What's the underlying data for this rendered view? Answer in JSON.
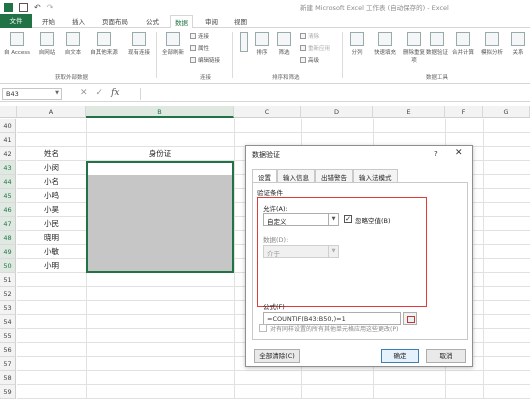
{
  "window": {
    "title": "新建 Microsoft Excel 工作表 (自动保存的) - Excel"
  },
  "tabs": [
    {
      "label": "文件"
    },
    {
      "label": "开始"
    },
    {
      "label": "插入"
    },
    {
      "label": "页面布局"
    },
    {
      "label": "公式"
    },
    {
      "label": "数据"
    },
    {
      "label": "审阅"
    },
    {
      "label": "视图"
    }
  ],
  "ribbon": {
    "get_external": {
      "label": "获取外部数据",
      "items": [
        "自 Access",
        "自网站",
        "自文本",
        "自其他来源",
        "现有连接"
      ]
    },
    "connections": {
      "label": "连接",
      "refresh_all": "全部刷新",
      "items": [
        "连接",
        "属性",
        "编辑链接"
      ]
    },
    "sort_filter": {
      "label": "排序和筛选",
      "sort": "排序",
      "filter": "筛选",
      "items": [
        "清除",
        "重新应用",
        "高级"
      ]
    },
    "data_tools": {
      "label": "数据工具",
      "items": [
        "分列",
        "快速填充",
        "删除重复项",
        "数据验证",
        "合并计算",
        "模拟分析",
        "关系"
      ]
    }
  },
  "formula_bar": {
    "name_box": "B43",
    "formula": ""
  },
  "columns": [
    "A",
    "B",
    "C",
    "D",
    "E",
    "F",
    "G"
  ],
  "rows": [
    {
      "num": "40",
      "a": "",
      "b": ""
    },
    {
      "num": "41",
      "a": "",
      "b": ""
    },
    {
      "num": "42",
      "a": "姓名",
      "b": "身份证"
    },
    {
      "num": "43",
      "a": "小闵",
      "b": ""
    },
    {
      "num": "44",
      "a": "小名",
      "b": ""
    },
    {
      "num": "45",
      "a": "小鸣",
      "b": ""
    },
    {
      "num": "46",
      "a": "小昊",
      "b": ""
    },
    {
      "num": "47",
      "a": "小民",
      "b": ""
    },
    {
      "num": "48",
      "a": "晓明",
      "b": ""
    },
    {
      "num": "49",
      "a": "小敏",
      "b": ""
    },
    {
      "num": "50",
      "a": "小明",
      "b": ""
    },
    {
      "num": "51",
      "a": "",
      "b": ""
    },
    {
      "num": "52",
      "a": "",
      "b": ""
    },
    {
      "num": "53",
      "a": "",
      "b": ""
    },
    {
      "num": "54",
      "a": "",
      "b": ""
    },
    {
      "num": "55",
      "a": "",
      "b": ""
    },
    {
      "num": "56",
      "a": "",
      "b": ""
    },
    {
      "num": "57",
      "a": "",
      "b": ""
    },
    {
      "num": "58",
      "a": "",
      "b": ""
    },
    {
      "num": "59",
      "a": "",
      "b": ""
    }
  ],
  "dialog": {
    "title": "数据验证",
    "help": "?",
    "close": "✕",
    "tabs": [
      "设置",
      "输入信息",
      "出错警告",
      "输入法模式"
    ],
    "section": "验证条件",
    "allow_label": "允许(A):",
    "allow_value": "自定义",
    "ignore_blank": "忽略空值(B)",
    "data_label": "数据(D):",
    "data_value": "介于",
    "formula_label": "公式(F)",
    "formula_value": "=COUNTIF(B43:B50,)=1",
    "apply_all": "对有同样设置的所有其他单元格应用这些更改(P)",
    "clear_all": "全部清除(C)",
    "ok": "确定",
    "cancel": "取消"
  },
  "colors": {
    "excel_green": "#217346",
    "selection_fill": "#c6c6c6",
    "highlight_red": "#e03a3a"
  }
}
